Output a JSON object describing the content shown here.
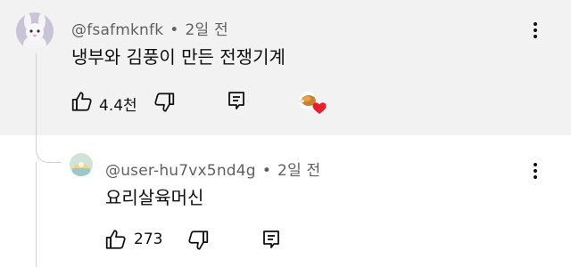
{
  "comment": {
    "author": "@fsafmknfk",
    "time": "2일 전",
    "text": "냉부와 김풍이 만든 전쟁기계",
    "like_count": "4.4천",
    "icons": {
      "avatar": "rabbit-avatar",
      "like": "thumbs-up-icon",
      "dislike": "thumbs-down-icon",
      "reply": "reply-icon",
      "menu": "more-vert-icon",
      "creator_heart": "creator-heart-icon"
    }
  },
  "reply": {
    "author": "@user-hu7vx5nd4g",
    "time": "2일 전",
    "text": "요리살육머신",
    "like_count": "273"
  },
  "separator": "•",
  "colors": {
    "top_background": "#f2f2f2",
    "reply_background": "#ffffff",
    "heart": "#e8202e",
    "meta_text": "#606060"
  }
}
